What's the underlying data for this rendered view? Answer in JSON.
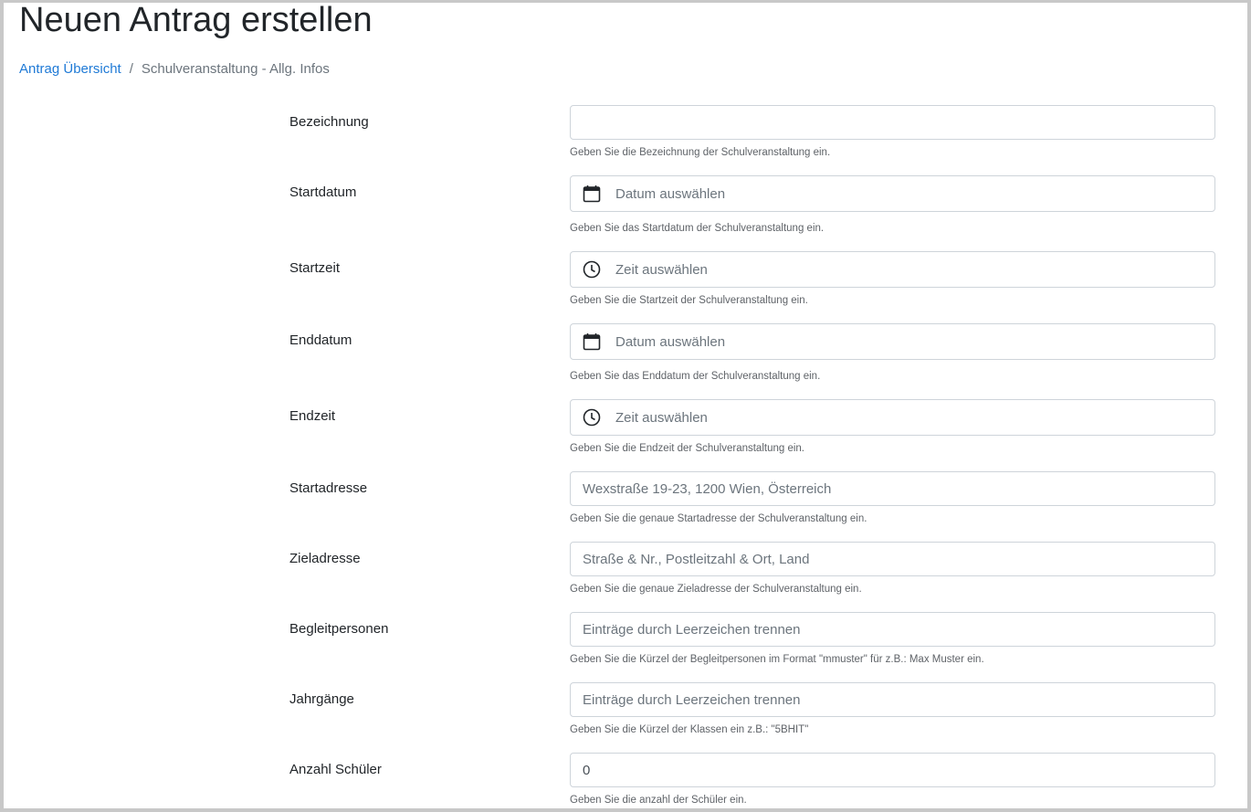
{
  "page": {
    "title": "Neuen Antrag erstellen"
  },
  "breadcrumb": {
    "link": "Antrag Übersicht",
    "separator": "/",
    "current": "Schulveranstaltung - Allg. Infos"
  },
  "form": {
    "bezeichnung": {
      "label": "Bezeichnung",
      "value": "",
      "help": "Geben Sie die Bezeichnung der Schulveranstaltung ein."
    },
    "startdatum": {
      "label": "Startdatum",
      "placeholder": "Datum auswählen",
      "icon": "calendar-icon",
      "help": "Geben Sie das Startdatum der Schulveranstaltung ein."
    },
    "startzeit": {
      "label": "Startzeit",
      "placeholder": "Zeit auswählen",
      "icon": "clock-icon",
      "help": "Geben Sie die Startzeit der Schulveranstaltung ein."
    },
    "enddatum": {
      "label": "Enddatum",
      "placeholder": "Datum auswählen",
      "icon": "calendar-icon",
      "help": "Geben Sie das Enddatum der Schulveranstaltung ein."
    },
    "endzeit": {
      "label": "Endzeit",
      "placeholder": "Zeit auswählen",
      "icon": "clock-icon",
      "help": "Geben Sie die Endzeit der Schulveranstaltung ein."
    },
    "startadresse": {
      "label": "Startadresse",
      "placeholder": "Wexstraße 19-23, 1200 Wien, Österreich",
      "help": "Geben Sie die genaue Startadresse der Schulveranstaltung ein."
    },
    "zieladresse": {
      "label": "Zieladresse",
      "placeholder": "Straße & Nr., Postleitzahl & Ort, Land",
      "help": "Geben Sie die genaue Zieladresse der Schulveranstaltung ein."
    },
    "begleitpersonen": {
      "label": "Begleitpersonen",
      "placeholder": "Einträge durch Leerzeichen trennen",
      "help": "Geben Sie die Kürzel der Begleitpersonen im Format \"mmuster\" für z.B.: Max Muster ein."
    },
    "jahrgaenge": {
      "label": "Jahrgänge",
      "placeholder": "Einträge durch Leerzeichen trennen",
      "help": "Geben Sie die Kürzel der Klassen ein z.B.: \"5BHIT\""
    },
    "anzahl_schueler": {
      "label": "Anzahl Schüler",
      "value": "0",
      "help": "Geben Sie die anzahl der Schüler ein."
    }
  },
  "colors": {
    "link": "#1f7ad6",
    "border": "#ced4da",
    "frame": "#c8c8c8"
  }
}
